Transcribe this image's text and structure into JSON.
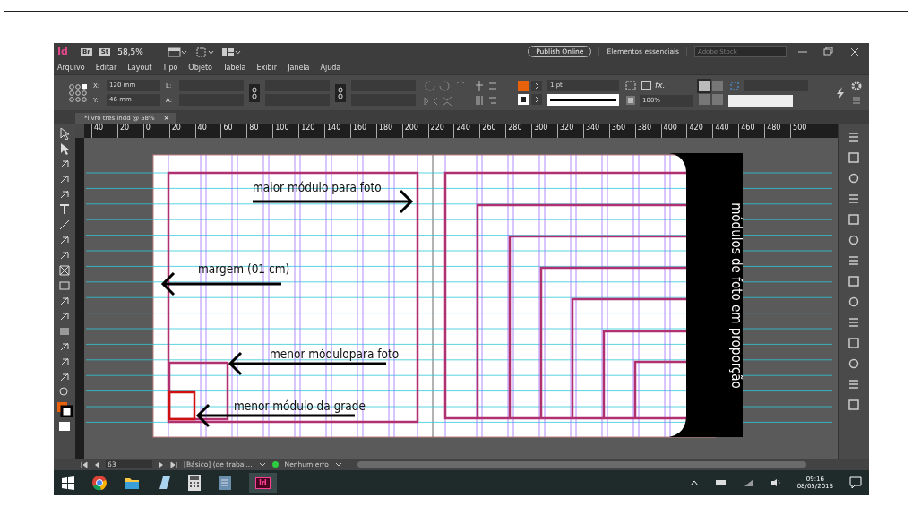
{
  "title_bar": {
    "app_label": "Id",
    "bridge_label": "Br",
    "stock_label": "St",
    "zoom": "58,5%",
    "publish_button": "Publish Online",
    "workspace": "Elementos essenciais",
    "stock_search": {
      "placeholder": "Adobe Stock"
    }
  },
  "menu": [
    "Arquivo",
    "Editar",
    "Layout",
    "Tipo",
    "Objeto",
    "Tabela",
    "Exibir",
    "Janela",
    "Ajuda"
  ],
  "control_panel": {
    "position_fields": [
      {
        "label": "X:",
        "value": "120 mm"
      },
      {
        "label": "Y:",
        "value": "46 mm"
      }
    ],
    "size_labels": [
      "L:",
      "A:"
    ],
    "stroke_weight": "1 pt",
    "opacity": "100%",
    "effects_label": "fx."
  },
  "document_tab": {
    "title": "*livro tres.indd @ 58%",
    "close": "×"
  },
  "ruler": {
    "labels": [
      "40",
      "20",
      "0",
      "20",
      "40",
      "60",
      "80",
      "100",
      "120",
      "140",
      "160",
      "180",
      "200",
      "220",
      "240",
      "260",
      "280",
      "300",
      "320",
      "340",
      "360",
      "380",
      "400",
      "420",
      "440",
      "460",
      "480",
      "500"
    ]
  },
  "canvas": {
    "vertical_label": "módulos de foto em proporção",
    "annotations": [
      {
        "text": "maior módulo para foto",
        "kind": "arrow_right"
      },
      {
        "text": "margem (01 cm)",
        "kind": "arrow_left"
      },
      {
        "text": "menor módulopara foto",
        "kind": "arrow_left"
      },
      {
        "text": "menor módulo da grade",
        "kind": "arrow_left"
      }
    ]
  },
  "status_bar": {
    "page": "63",
    "style": "[Básico] (de trabal...",
    "preflight": "Nenhum erro"
  },
  "taskbar": {
    "app_label": "Id",
    "time": "09:16",
    "date": "08/05/2018"
  }
}
